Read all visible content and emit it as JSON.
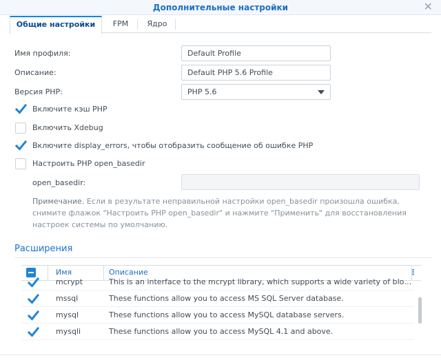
{
  "window": {
    "title": "Дополнительные настройки"
  },
  "tabs": [
    {
      "label": "Общие настройки"
    },
    {
      "label": "FPM"
    },
    {
      "label": "Ядро"
    }
  ],
  "form": {
    "profile_name_label": "Имя профиля:",
    "profile_name_value": "Default Profile",
    "description_label": "Описание:",
    "description_value": "Default PHP 5.6 Profile",
    "php_version_label": "Версия PHP:",
    "php_version_value": "PHP 5.6"
  },
  "checkboxes": [
    {
      "label": "Включите кэш PHP",
      "checked": true
    },
    {
      "label": "Включить Xdebug",
      "checked": false
    },
    {
      "label": "Включите display_errors, чтобы отобразить сообщение об ошибке PHP",
      "checked": true
    },
    {
      "label": "Настроить PHP open_basedir",
      "checked": false
    }
  ],
  "open_basedir": {
    "label": "open_basedir:",
    "value": ""
  },
  "note": {
    "prefix": "Примечание.",
    "text": " Если в результате неправильной настройки open_basedir произошла ошибка, снимите флажок \"Настроить PHP open_basedir\" и нажмите \"Применить\" для восстановления настроек системы по умолчанию."
  },
  "extensions": {
    "section_title": "Расширения",
    "columns": {
      "name": "Имя",
      "description": "Описание"
    },
    "rows": [
      {
        "name": "mcrypt",
        "description": "This is an interface to the mcrypt library, which supports a wide variety of block al...",
        "checked": true
      },
      {
        "name": "mssql",
        "description": "These functions allow you to access MS SQL Server database.",
        "checked": true
      },
      {
        "name": "mysql",
        "description": "These functions allow you to access MySQL database servers.",
        "checked": true
      },
      {
        "name": "mysqli",
        "description": "These functions allow you to access MySQL 4.1 and above.",
        "checked": true
      }
    ]
  },
  "colors": {
    "accent": "#1d6fc7",
    "check": "#1d84d8"
  }
}
